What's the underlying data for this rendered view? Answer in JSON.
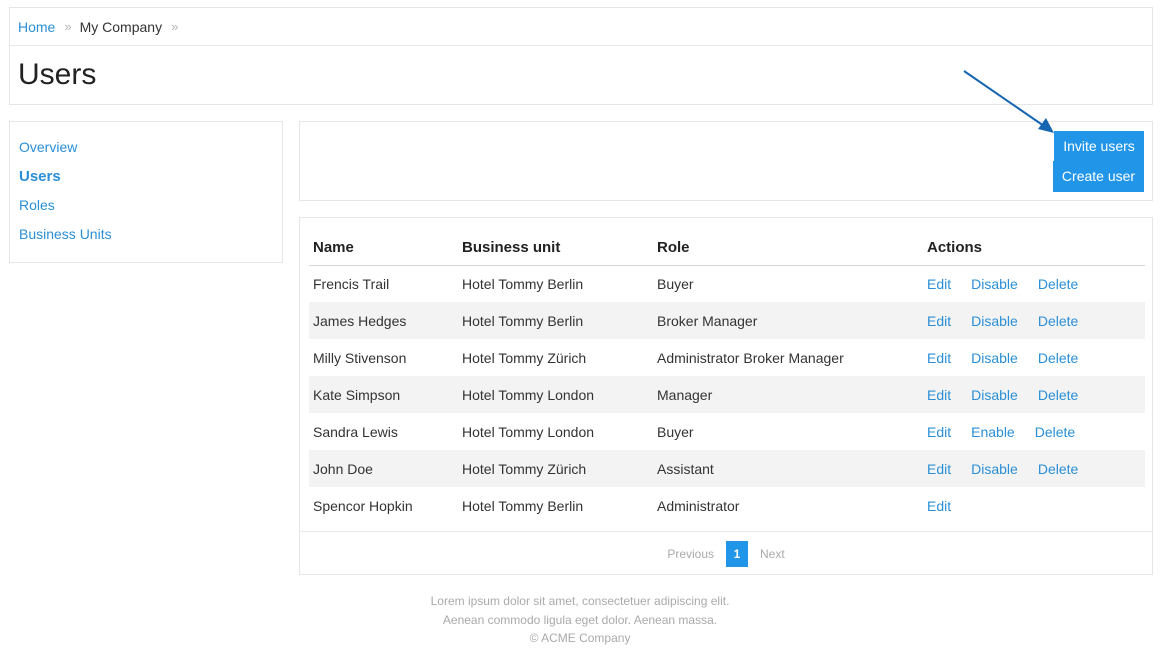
{
  "breadcrumb": {
    "home": "Home",
    "current": "My Company",
    "separator": "»"
  },
  "page_title": "Users",
  "sidebar": {
    "items": [
      {
        "label": "Overview",
        "active": false
      },
      {
        "label": "Users",
        "active": true
      },
      {
        "label": "Roles",
        "active": false
      },
      {
        "label": "Business Units",
        "active": false
      }
    ]
  },
  "toolbar": {
    "invite_label": "Invite users",
    "create_label": "Create user"
  },
  "table": {
    "headers": {
      "name": "Name",
      "unit": "Business unit",
      "role": "Role",
      "actions": "Actions"
    },
    "rows": [
      {
        "name": "Frencis Trail",
        "unit": "Hotel Tommy Berlin",
        "role": "Buyer",
        "edit": "Edit",
        "toggle": "Disable",
        "delete": "Delete"
      },
      {
        "name": "James Hedges",
        "unit": "Hotel Tommy Berlin",
        "role": "Broker Manager",
        "edit": "Edit",
        "toggle": "Disable",
        "delete": "Delete"
      },
      {
        "name": "Milly Stivenson",
        "unit": "Hotel Tommy Zürich",
        "role": "Administrator Broker Manager",
        "edit": "Edit",
        "toggle": "Disable",
        "delete": "Delete"
      },
      {
        "name": "Kate Simpson",
        "unit": "Hotel Tommy London",
        "role": "Manager",
        "edit": "Edit",
        "toggle": "Disable",
        "delete": "Delete"
      },
      {
        "name": "Sandra Lewis",
        "unit": "Hotel Tommy London",
        "role": "Buyer",
        "edit": "Edit",
        "toggle": "Enable",
        "delete": "Delete"
      },
      {
        "name": "John Doe",
        "unit": "Hotel Tommy Zürich",
        "role": "Assistant",
        "edit": "Edit",
        "toggle": "Disable",
        "delete": "Delete"
      },
      {
        "name": "Spencor Hopkin",
        "unit": "Hotel Tommy Berlin",
        "role": "Administrator",
        "edit": "Edit",
        "toggle": null,
        "delete": null
      }
    ]
  },
  "pagination": {
    "previous": "Previous",
    "current_page": "1",
    "next": "Next"
  },
  "footer": {
    "line1": "Lorem ipsum dolor sit amet, consectetuer adipiscing elit.",
    "line2": "Aenean commodo ligula eget dolor. Aenean massa.",
    "line3": "© ACME Company"
  },
  "colors": {
    "accent": "#2196e8",
    "link": "#2a8fd6",
    "arrow": "#1565b0"
  }
}
